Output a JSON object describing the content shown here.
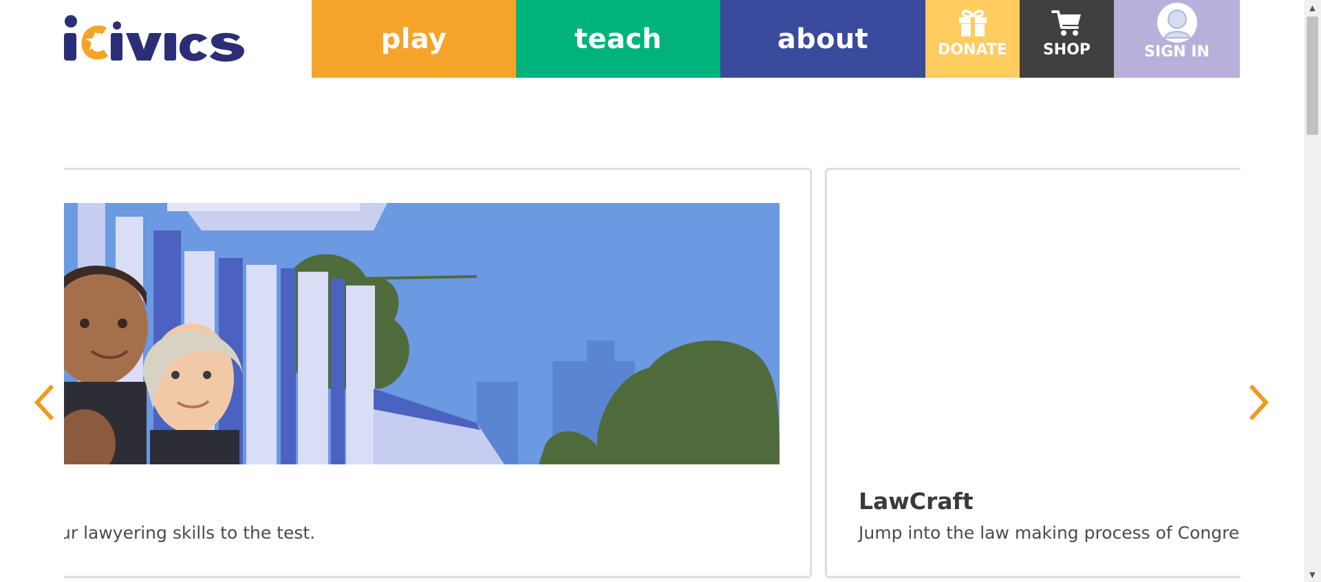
{
  "brand": {
    "name": "iCivics",
    "logo_text": "iCIVICS"
  },
  "nav": {
    "play": "play",
    "teach": "teach",
    "about": "about",
    "donate": "DONATE",
    "shop": "SHOP",
    "sign_in": "SIGN IN"
  },
  "carousel": {
    "cards": [
      {
        "title": "",
        "description": "ur lawyering skills to the test.",
        "image": "courthouse-illustration"
      },
      {
        "title": "LawCraft",
        "description": "Jump into the law making process of Congre",
        "image": ""
      }
    ]
  },
  "colors": {
    "play": "#f5a42a",
    "teach": "#00b37c",
    "about": "#3a4a9c",
    "donate": "#fecc5f",
    "shop": "#404040",
    "sign_in": "#b8b0da",
    "logo_navy": "#2b2e77",
    "logo_orange": "#f5a42a",
    "arrow": "#f29a1c"
  }
}
